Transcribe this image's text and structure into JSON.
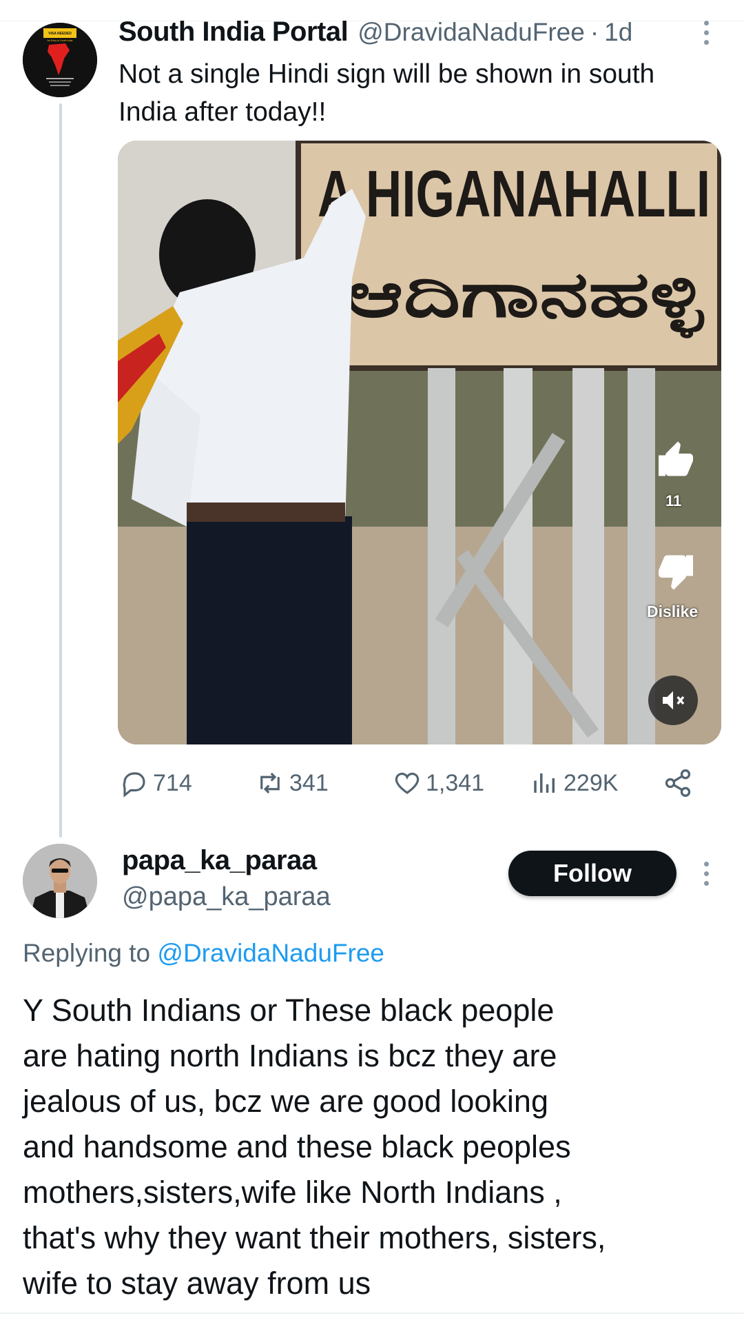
{
  "tweet": {
    "author_name": "South India Portal",
    "author_handle": "@DravidaNaduFree",
    "separator": "·",
    "time": "1d",
    "text": "Not a single Hindi sign will be shown in south India after today!!",
    "avatar": {
      "badge_text": "VISA NEEDED",
      "badge_subtext": "for Entry to South India"
    },
    "media": {
      "sign_english": "A HIGANAHALLI",
      "sign_kannada": "ಆದಿಗಾನಹಳ್ಳಿ",
      "like_count": "11",
      "dislike_label": "Dislike"
    },
    "stats": {
      "replies": "714",
      "retweets": "341",
      "likes": "1,341",
      "views": "229K"
    }
  },
  "reply": {
    "author_name": "papa_ka_paraa",
    "author_handle": "@papa_ka_paraa",
    "follow_label": "Follow",
    "replying_prefix": "Replying to",
    "replying_to": "@DravidaNaduFree",
    "body_lines": [
      "Y South Indians or These black people",
      "are hating north Indians is bcz they are",
      "jealous of us, bcz we are good looking",
      "and handsome and these black peoples",
      "mothers,sisters,wife like North Indians ,",
      "that's why they want their mothers, sisters,",
      "wife to stay away from us"
    ]
  },
  "icons": {
    "reply": "reply-icon",
    "retweet": "retweet-icon",
    "like": "heart-icon",
    "views": "views-icon",
    "share": "share-icon",
    "more": "more-vertical-icon",
    "mute": "mute-icon"
  },
  "colors": {
    "text_primary": "#0f1419",
    "text_secondary": "#536471",
    "link": "#1d9bf0",
    "follow_bg": "#0f1419",
    "thread_line": "#cfd9de"
  }
}
